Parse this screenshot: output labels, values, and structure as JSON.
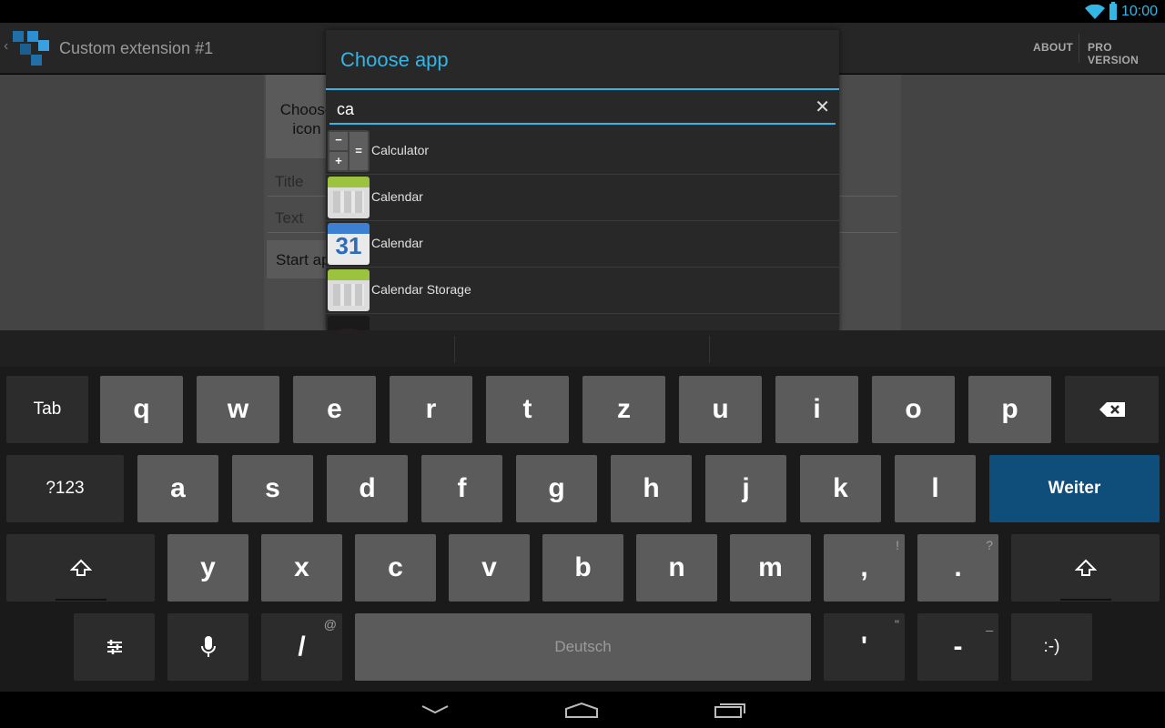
{
  "status_bar": {
    "time": "10:00",
    "wifi_icon": "wifi-icon",
    "battery_icon": "battery-icon"
  },
  "action_bar": {
    "title": "Custom extension #1",
    "actions": [
      "ABOUT",
      "PRO VERSION"
    ]
  },
  "background_form": {
    "choose_icon_label": "Choose icon",
    "title_placeholder": "Title",
    "text_placeholder": "Text",
    "start_app_label": "Start app"
  },
  "dialog": {
    "title": "Choose app",
    "search_value": "ca",
    "items": [
      {
        "label": "Calculator",
        "icon": "calculator-icon"
      },
      {
        "label": "Calendar",
        "icon": "calendar-icon"
      },
      {
        "label": "Calendar",
        "icon": "google-calendar-icon"
      },
      {
        "label": "Calendar Storage",
        "icon": "calendar-storage-icon"
      },
      {
        "label": "",
        "icon": "app-icon"
      }
    ]
  },
  "keyboard": {
    "row1": [
      "Tab",
      "q",
      "w",
      "e",
      "r",
      "t",
      "z",
      "u",
      "i",
      "o",
      "p"
    ],
    "row2": [
      "?123",
      "a",
      "s",
      "d",
      "f",
      "g",
      "h",
      "j",
      "k",
      "l",
      "Weiter"
    ],
    "row3": [
      "y",
      "x",
      "c",
      "v",
      "b",
      "n",
      "m",
      ",",
      "."
    ],
    "row3_hints": [
      "!",
      "?"
    ],
    "row4": [
      "/",
      "Deutsch",
      "'",
      "-",
      ":-)"
    ],
    "row4_hints": [
      "@",
      "\"",
      "_"
    ],
    "enter_color": "#0f4d7a"
  },
  "colors": {
    "accent": "#33b5e5"
  }
}
